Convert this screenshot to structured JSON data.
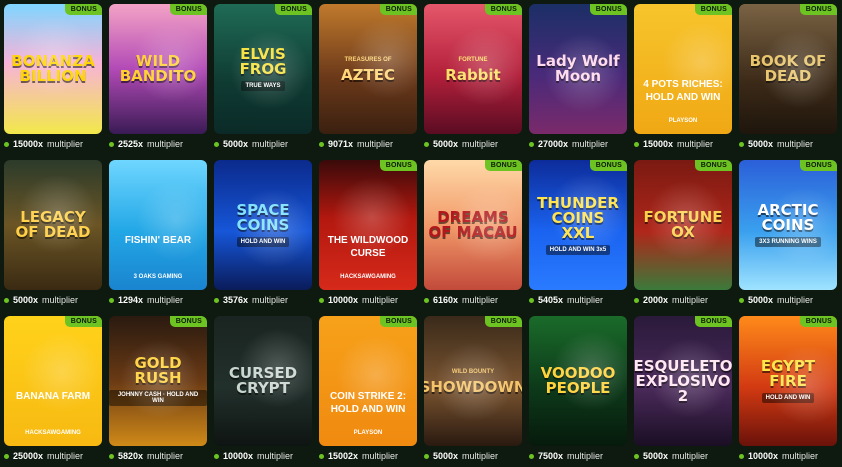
{
  "badge_label": "BONUS",
  "multiplier_word": "multiplier",
  "accent": "#6cc321",
  "games": [
    {
      "title": "BONANZA BILLION",
      "subtitle": "",
      "provider": "",
      "style": "art",
      "bonus": true,
      "multiplier": "15000x",
      "bg": "linear-gradient(180deg,#7fd6ff 0%,#f7b3d8 45%,#f2e84a 100%)",
      "color": "#ffd400"
    },
    {
      "title": "WILD BANDITO",
      "subtitle": "",
      "provider": "",
      "style": "art",
      "bonus": true,
      "multiplier": "2525x",
      "bg": "linear-gradient(180deg,#f4a3c6 0%,#b24ab6 50%,#3a1b55 100%)",
      "color": "#ffcf2e"
    },
    {
      "title": "ELVIS FROG",
      "subtitle": "TRUE WAYS",
      "provider": "",
      "style": "art",
      "bonus": true,
      "multiplier": "5000x",
      "bg": "linear-gradient(180deg,#1f6b55 0%,#0f3b33 60%,#0b2a27 100%)",
      "color": "#f6e13a"
    },
    {
      "title": "AZTEC",
      "subtitle": "TREASURES OF",
      "provider": "",
      "style": "art",
      "bonus": true,
      "multiplier": "9071x",
      "bg": "linear-gradient(180deg,#c07a2c 0%,#6d3a1a 55%,#3a2010 100%)",
      "color": "#ffd77a"
    },
    {
      "title": "Rabbit",
      "subtitle": "FORTUNE",
      "provider": "",
      "style": "art",
      "bonus": true,
      "multiplier": "5000x",
      "bg": "linear-gradient(180deg,#e5576b 0%,#b21f3a 55%,#5a0c23 100%)",
      "color": "#ffe066"
    },
    {
      "title": "Lady Wolf Moon",
      "subtitle": "",
      "provider": "",
      "style": "art",
      "bonus": true,
      "multiplier": "27000x",
      "bg": "linear-gradient(180deg,#1b2f66 0%,#4a2a7a 55%,#7a2a6a 100%)",
      "color": "#ffd8ec"
    },
    {
      "title": "4 POTS RICHES: HOLD AND WIN",
      "subtitle": "",
      "provider": "PLAYSON",
      "style": "plain",
      "bonus": true,
      "multiplier": "15000x",
      "bg": "linear-gradient(180deg,#f7c52c 0%,#f0a814 100%)",
      "color": "#ffffff"
    },
    {
      "title": "BOOK OF DEAD",
      "subtitle": "",
      "provider": "",
      "style": "art",
      "bonus": true,
      "multiplier": "5000x",
      "bg": "linear-gradient(180deg,#7a6344 0%,#3c2a18 60%,#1e150c 100%)",
      "color": "#e8c46a"
    },
    {
      "title": "LEGACY OF DEAD",
      "subtitle": "",
      "provider": "",
      "style": "art",
      "bonus": false,
      "multiplier": "5000x",
      "bg": "linear-gradient(180deg,#2c3b2a 0%,#6b5525 50%,#3a2a12 100%)",
      "color": "#ffcf45"
    },
    {
      "title": "FISHIN' BEAR",
      "subtitle": "",
      "provider": "3 OAKS GAMING",
      "style": "plain",
      "bonus": false,
      "multiplier": "1294x",
      "bg": "linear-gradient(180deg,#6fd6ff 0%,#22a7e6 55%,#1a84cf 100%)",
      "color": "#ffffff"
    },
    {
      "title": "SPACE COINS",
      "subtitle": "HOLD AND WIN",
      "provider": "",
      "style": "art",
      "bonus": false,
      "multiplier": "3576x",
      "bg": "linear-gradient(180deg,#0b2a8c 0%,#1656d8 55%,#0a1c5a 100%)",
      "color": "#7ee0ff"
    },
    {
      "title": "THE WILDWOOD CURSE",
      "subtitle": "",
      "provider": "HACKSAWGAMING",
      "style": "plain",
      "bonus": true,
      "multiplier": "10000x",
      "bg": "linear-gradient(180deg,#3a0a0a 0%,#b3180f 45%,#d62a1a 100%)",
      "color": "#ffffff"
    },
    {
      "title": "DREAMS OF MACAU",
      "subtitle": "",
      "provider": "",
      "style": "art",
      "bonus": true,
      "multiplier": "6160x",
      "bg": "linear-gradient(180deg,#ffd9a8 0%,#f29a6a 50%,#c24a3a 100%)",
      "color": "#b3171b"
    },
    {
      "title": "THUNDER COINS XXL",
      "subtitle": "HOLD AND WIN 3x5",
      "provider": "",
      "style": "art",
      "bonus": true,
      "multiplier": "5405x",
      "bg": "linear-gradient(180deg,#0d2c9a 0%,#1a63f0 55%,#2a7bff 100%)",
      "color": "#ffe34a"
    },
    {
      "title": "FORTUNE OX",
      "subtitle": "",
      "provider": "",
      "style": "art",
      "bonus": true,
      "multiplier": "2000x",
      "bg": "linear-gradient(180deg,#7a1a12 0%,#b0261a 55%,#3b7a3a 100%)",
      "color": "#ffd14a"
    },
    {
      "title": "ARCTIC COINS",
      "subtitle": "3X3 RUNNING WINS",
      "provider": "",
      "style": "art",
      "bonus": true,
      "multiplier": "5000x",
      "bg": "linear-gradient(180deg,#2b5fd9 0%,#3aa0ee 55%,#9fe3ff 100%)",
      "color": "#ffffff"
    },
    {
      "title": "BANANA FARM",
      "subtitle": "",
      "provider": "HACKSAWGAMING",
      "style": "plain",
      "bonus": true,
      "multiplier": "25000x",
      "bg": "linear-gradient(180deg,#ffd21a 0%,#f7b912 100%)",
      "color": "#ffffff"
    },
    {
      "title": "GOLD RUSH",
      "subtitle": "JOHNNY CASH · HOLD AND WIN",
      "provider": "",
      "style": "art",
      "bonus": true,
      "multiplier": "5820x",
      "bg": "linear-gradient(180deg,#2a1a10 0%,#6a3a14 50%,#d08a18 100%)",
      "color": "#ffd23a"
    },
    {
      "title": "CURSED CRYPT",
      "subtitle": "",
      "provider": "",
      "style": "art",
      "bonus": false,
      "multiplier": "10000x",
      "bg": "linear-gradient(180deg,#1a2420 0%,#22302c 55%,#0e1412 100%)",
      "color": "#c9d6d0"
    },
    {
      "title": "COIN STRIKE 2: HOLD AND WIN",
      "subtitle": "",
      "provider": "PLAYSON",
      "style": "plain",
      "bonus": true,
      "multiplier": "15002x",
      "bg": "linear-gradient(180deg,#f7a11a 0%,#f08a10 100%)",
      "color": "#ffffff"
    },
    {
      "title": "SHOWDOWN",
      "subtitle": "WILD BOUNTY",
      "provider": "",
      "style": "art",
      "bonus": true,
      "multiplier": "5000x",
      "bg": "linear-gradient(180deg,#3a2a1a 0%,#7a5430 55%,#2a1a10 100%)",
      "color": "#f3c46a"
    },
    {
      "title": "VOODOO PEOPLE",
      "subtitle": "",
      "provider": "",
      "style": "art",
      "bonus": false,
      "multiplier": "7500x",
      "bg": "linear-gradient(180deg,#1a6b2a 0%,#0d3a1a 55%,#061a0c 100%)",
      "color": "#ffd23a"
    },
    {
      "title": "ESQUELETO EXPLOSIVO 2",
      "subtitle": "",
      "provider": "",
      "style": "art",
      "bonus": true,
      "multiplier": "5000x",
      "bg": "linear-gradient(180deg,#2a1a3a 0%,#4a2a5a 55%,#1a0e24 100%)",
      "color": "#ffe6f2"
    },
    {
      "title": "EGYPT FIRE",
      "subtitle": "HOLD AND WIN",
      "provider": "",
      "style": "art",
      "bonus": true,
      "multiplier": "10000x",
      "bg": "linear-gradient(180deg,#ff8a1a 0%,#d23a12 55%,#6a120a 100%)",
      "color": "#ffe54a"
    }
  ]
}
